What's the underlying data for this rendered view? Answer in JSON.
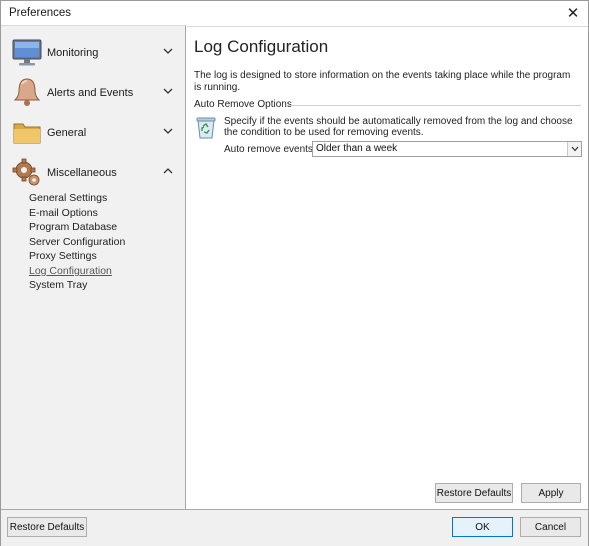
{
  "window": {
    "title": "Preferences"
  },
  "sidebar": {
    "groups": [
      {
        "label": "Monitoring",
        "icon": "monitor-icon",
        "expanded": false
      },
      {
        "label": "Alerts and Events",
        "icon": "bell-icon",
        "expanded": false
      },
      {
        "label": "General",
        "icon": "folder-icon",
        "expanded": false
      },
      {
        "label": "Miscellaneous",
        "icon": "gear-icon",
        "expanded": true
      }
    ],
    "items": [
      {
        "label": "General Settings",
        "active": false
      },
      {
        "label": "E-mail Options",
        "active": false
      },
      {
        "label": "Program Database",
        "active": false
      },
      {
        "label": "Server Configuration",
        "active": false
      },
      {
        "label": "Proxy Settings",
        "active": false
      },
      {
        "label": "Log Configuration",
        "active": true
      },
      {
        "label": "System Tray",
        "active": false
      }
    ]
  },
  "content": {
    "title": "Log Configuration",
    "description": "The log is designed to store information on the events taking place while the program is running.",
    "section_label": "Auto Remove Options",
    "option_description": "Specify if the events should be automatically removed from the log and choose the condition to be used for removing events.",
    "field_label": "Auto remove events:",
    "field_value": "Older than a week",
    "restore_defaults_label": "Restore Defaults",
    "apply_label": "Apply"
  },
  "footer": {
    "restore_defaults_label": "Restore Defaults",
    "ok_label": "OK",
    "cancel_label": "Cancel"
  },
  "colors": {
    "accent": "#0078d7",
    "sidebar_bg": "#f1f1f1",
    "footer_bg": "#f0f0f0"
  }
}
